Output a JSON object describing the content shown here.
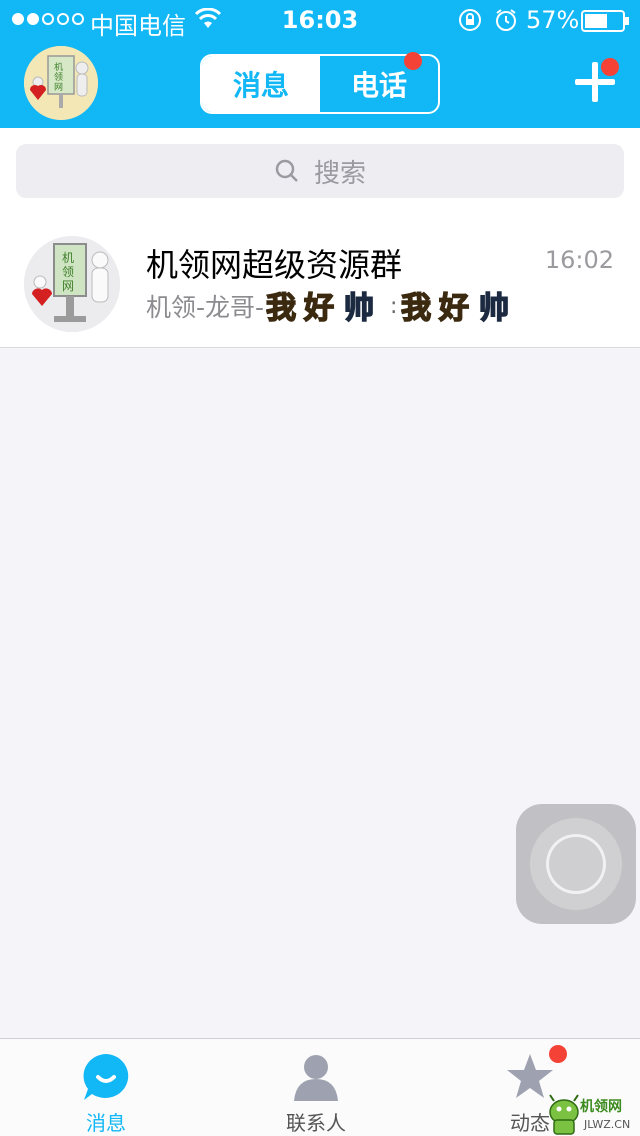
{
  "status_bar": {
    "carrier": "中国电信",
    "time": "16:03",
    "battery": "57%",
    "battery_level": 0.57,
    "signal_bars": 2
  },
  "header": {
    "tabs": [
      {
        "label": "消息",
        "active": true
      },
      {
        "label": "电话",
        "active": false,
        "badge": true
      }
    ],
    "accent_color": "#12b7f5",
    "badge_color": "#f44336"
  },
  "search": {
    "placeholder": "搜索"
  },
  "conversations": [
    {
      "title": "机领网超级资源群",
      "time": "16:02",
      "preview_prefix": "机领-龙哥-",
      "preview_separator": ":",
      "stickers": [
        "我好帅",
        "我好帅"
      ]
    }
  ],
  "tabbar": {
    "items": [
      {
        "label": "消息",
        "icon": "message-bubble-icon",
        "active": true
      },
      {
        "label": "联系人",
        "icon": "contacts-person-icon",
        "active": false
      },
      {
        "label": "动态",
        "icon": "star-icon",
        "active": false,
        "badge": true
      }
    ]
  },
  "watermark": {
    "text": "机领网",
    "sub": "JLWZ.CN"
  }
}
